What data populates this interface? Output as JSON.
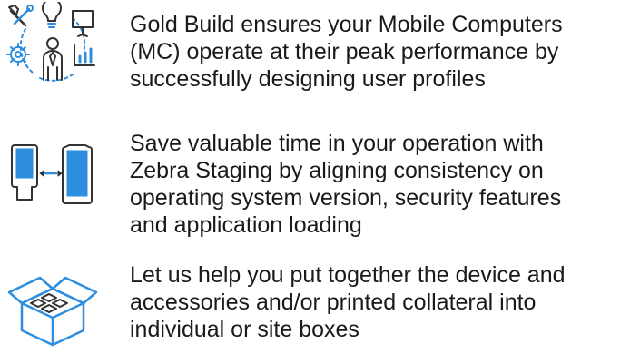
{
  "features": [
    {
      "icon": "performance-icon",
      "lines": [
        "Gold Build ensures your Mobile Computers",
        "(MC) operate at their peak performance by",
        "successfully designing user profiles"
      ]
    },
    {
      "icon": "mobile-staging-icon",
      "lines": [
        "Save valuable time in your operation with",
        "Zebra Staging by aligning consistency on",
        "operating system version, security features",
        "and application loading"
      ]
    },
    {
      "icon": "open-box-icon",
      "lines": [
        "Let us help you put together the device and",
        "accessories and/or printed collateral into",
        "individual or site boxes"
      ]
    }
  ],
  "colors": {
    "accent": "#2d8ee0",
    "outline": "#333333",
    "text": "#1a1a1a"
  }
}
